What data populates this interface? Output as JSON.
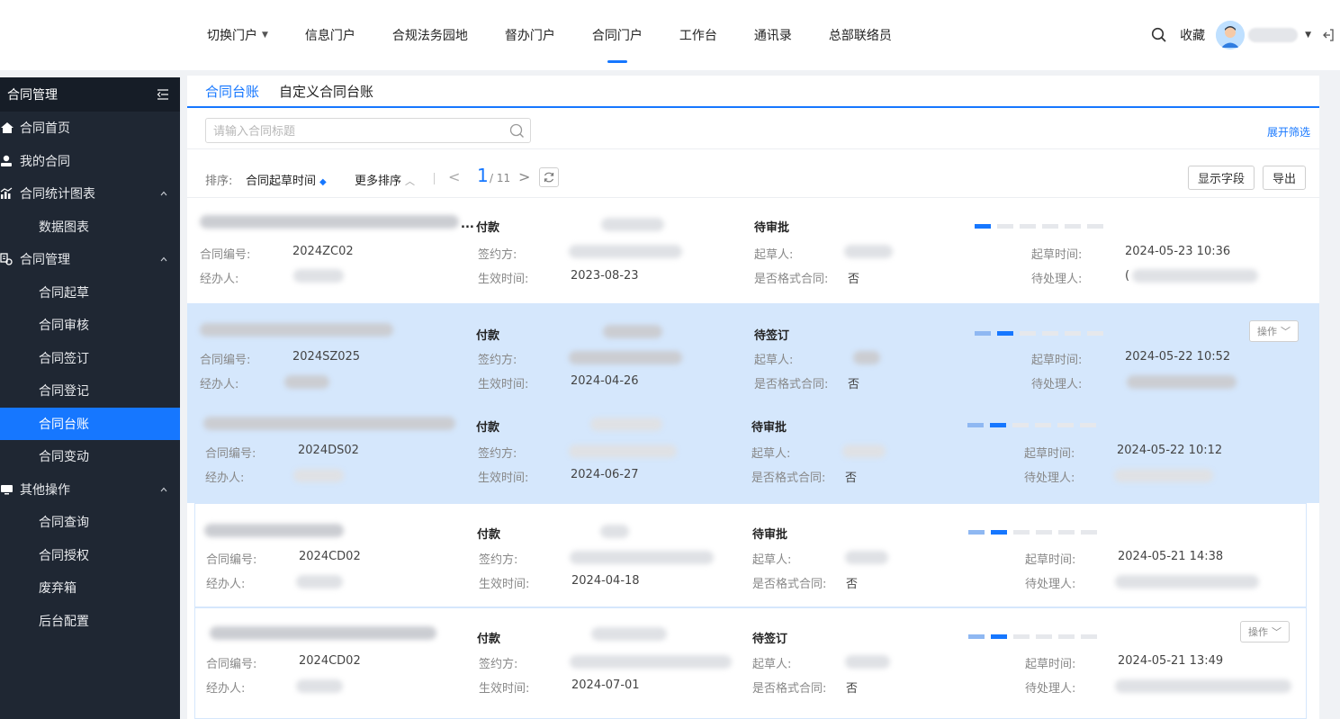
{
  "nav": {
    "items": [
      {
        "label": "切换门户",
        "dropdown": true
      },
      {
        "label": "信息门户"
      },
      {
        "label": "合规法务园地"
      },
      {
        "label": "督办门户"
      },
      {
        "label": "合同门户",
        "active": true
      },
      {
        "label": "工作台"
      },
      {
        "label": "通讯录"
      },
      {
        "label": "总部联络员"
      }
    ],
    "favorites_label": "收藏"
  },
  "sidebar": {
    "title": "合同管理",
    "items": [
      {
        "label": "合同首页",
        "icon": "home-icon",
        "level": 1
      },
      {
        "label": "我的合同",
        "icon": "user-icon",
        "level": 1
      },
      {
        "label": "合同统计图表",
        "icon": "chart-icon",
        "level": 1,
        "expanded": true
      },
      {
        "label": "数据图表",
        "level": 2
      },
      {
        "label": "合同管理",
        "icon": "contract-icon",
        "level": 1,
        "expanded": true
      },
      {
        "label": "合同起草",
        "level": 2
      },
      {
        "label": "合同审核",
        "level": 2
      },
      {
        "label": "合同签订",
        "level": 2
      },
      {
        "label": "合同登记",
        "level": 2
      },
      {
        "label": "合同台账",
        "level": 2,
        "selected": true
      },
      {
        "label": "合同变动",
        "level": 2
      },
      {
        "label": "其他操作",
        "icon": "monitor-icon",
        "level": 1,
        "expanded": true
      },
      {
        "label": "合同查询",
        "level": 2
      },
      {
        "label": "合同授权",
        "level": 2
      },
      {
        "label": "废弃箱",
        "level": 2
      },
      {
        "label": "后台配置",
        "level": 2
      }
    ]
  },
  "tabs": [
    {
      "label": "合同台账",
      "active": true
    },
    {
      "label": "自定义合同台账"
    }
  ],
  "search": {
    "placeholder": "请输入合同标题",
    "expand_filter": "展开筛选"
  },
  "toolbar": {
    "sort_label": "排序:",
    "sort_field": "合同起草时间",
    "more_sort": "更多排序",
    "page_current": "1",
    "page_total": "/ 11",
    "show_fields": "显示字段",
    "export": "导出"
  },
  "labels": {
    "contract_no": "合同编号:",
    "handler": "经办人:",
    "signer": "签约方:",
    "effective_date": "生效时间:",
    "drafter": "起草人:",
    "is_template": "是否格式合同:",
    "draft_time": "起草时间:",
    "pending": "待处理人:",
    "operate": "操作"
  },
  "contracts": [
    {
      "title_suffix": "...",
      "type": "付款",
      "status": "待审批",
      "contract_no": "2024ZC02",
      "effective_date": "2023-08-23",
      "is_template": "否",
      "draft_time": "2024-05-23 10:36",
      "pending_prefix": "(",
      "progress": {
        "done": 0,
        "current": 1,
        "total": 6
      }
    },
    {
      "title_suffix": "",
      "type": "付款",
      "status": "待签订",
      "contract_no": "2024SZ025",
      "effective_date": "2024-04-26",
      "is_template": "否",
      "draft_time": "2024-05-22 10:52",
      "pending_prefix": "",
      "progress": {
        "done": 1,
        "current": 1,
        "total": 6
      }
    },
    {
      "title_suffix": "",
      "type": "付款",
      "status": "待审批",
      "contract_no": "2024DS02",
      "effective_date": "2024-06-27",
      "is_template": "否",
      "draft_time": "2024-05-22 10:12",
      "pending_prefix": "",
      "progress": {
        "done": 1,
        "current": 1,
        "total": 6
      }
    },
    {
      "title_suffix": "",
      "type": "付款",
      "status": "待审批",
      "contract_no": "2024CD02",
      "effective_date": "2024-04-18",
      "is_template": "否",
      "draft_time": "2024-05-21 14:38",
      "pending_prefix": "",
      "progress": {
        "done": 1,
        "current": 1,
        "total": 6
      }
    },
    {
      "title_suffix": "",
      "type": "付款",
      "status": "待签订",
      "contract_no": "2024CD02",
      "effective_date": "2024-07-01",
      "is_template": "否",
      "draft_time": "2024-05-21 13:49",
      "pending_prefix": "",
      "progress": {
        "done": 1,
        "current": 1,
        "total": 6
      }
    }
  ],
  "colors": {
    "accent": "#1677ff",
    "sidebar_bg": "#1f2733",
    "highlight_row": "#d5e7fc"
  }
}
